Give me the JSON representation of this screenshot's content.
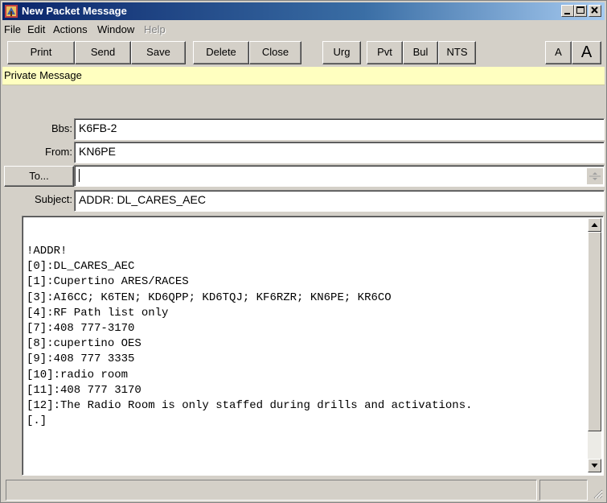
{
  "window": {
    "title": "New Packet Message"
  },
  "menu": {
    "items": [
      "File",
      "Edit",
      "Actions",
      "Window",
      "Help"
    ]
  },
  "toolbar": {
    "print": "Print",
    "send": "Send",
    "save": "Save",
    "delete": "Delete",
    "close": "Close",
    "urg": "Urg",
    "pvt": "Pvt",
    "bul": "Bul",
    "nts": "NTS",
    "font_smaller": "A",
    "font_larger": "A"
  },
  "banner": {
    "text": "Private Message",
    "color": "#ffffc0"
  },
  "form": {
    "bbs_label": "Bbs:",
    "bbs_value": "K6FB-2",
    "from_label": "From:",
    "from_value": "KN6PE",
    "to_button": "To...",
    "to_value": "",
    "subject_label": "Subject:",
    "subject_value": "ADDR: DL_CARES_AEC"
  },
  "message": {
    "lines": [
      "!ADDR!",
      "[0]:DL_CARES_AEC",
      "[1]:Cupertino ARES/RACES",
      "[3]:AI6CC; K6TEN; KD6QPP; KD6TQJ; KF6RZR; KN6PE; KR6CO",
      "[4]:RF Path list only",
      "[7]:408 777-3170",
      "[8]:cupertino OES",
      "[9]:408 777 3335",
      "[10]:radio room",
      "[11]:408 777 3170",
      "[12]:The Radio Room is only staffed during drills and activations.",
      "[.]"
    ]
  },
  "status": {
    "panel1": "",
    "panel2": ""
  },
  "colors": {
    "titlebar_start": "#0a246a",
    "titlebar_end": "#a6caf0",
    "face": "#d4d0c8"
  }
}
